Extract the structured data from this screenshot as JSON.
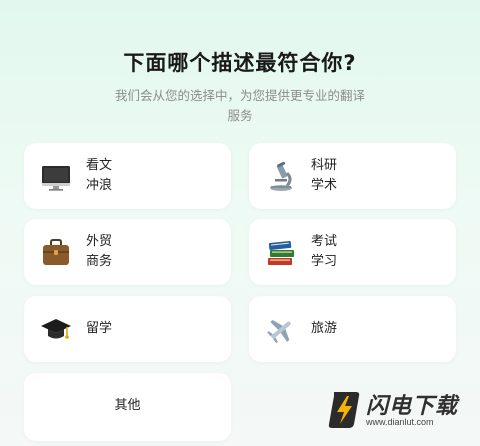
{
  "header": {
    "title": "下面哪个描述最符合你?",
    "subtitle": "我们会从您的选择中，为您提供更专业的翻译服务"
  },
  "options": [
    {
      "line1": "看文",
      "line2": "冲浪",
      "icon": "computer-icon"
    },
    {
      "line1": "科研",
      "line2": "学术",
      "icon": "microscope-icon"
    },
    {
      "line1": "外贸",
      "line2": "商务",
      "icon": "briefcase-icon"
    },
    {
      "line1": "考试",
      "line2": "学习",
      "icon": "books-icon"
    },
    {
      "line1": "留学",
      "icon": "graduation-cap-icon"
    },
    {
      "line1": "旅游",
      "icon": "airplane-icon"
    },
    {
      "line1": "其他"
    }
  ],
  "watermark": {
    "text": "闪电下载",
    "url": "www.dianlut.com"
  }
}
